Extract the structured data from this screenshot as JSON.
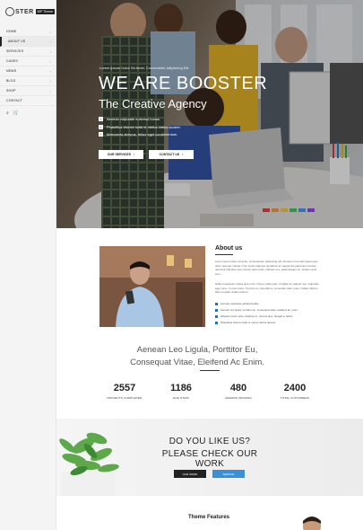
{
  "logo": {
    "text": "STER",
    "badge": "WP Theme"
  },
  "nav": {
    "items": [
      {
        "label": "HOME",
        "chevron": "›"
      },
      {
        "label": "ABOUT US",
        "chevron": "›"
      },
      {
        "label": "SERVICES",
        "chevron": "›"
      },
      {
        "label": "CASES",
        "chevron": "›"
      },
      {
        "label": "NEWS",
        "chevron": "›"
      },
      {
        "label": "BLOG",
        "chevron": "›"
      },
      {
        "label": "SHOP",
        "chevron": "›"
      },
      {
        "label": "CONTACT",
        "chevron": ""
      }
    ],
    "search_icon": "⌕",
    "cart_icon": "🛒"
  },
  "hero": {
    "small": "Lorem ipsum Dolor Sit Amet, Consectetur Adipiscing Elit.",
    "title": "WE ARE BOOSTER",
    "subtitle": "The Creative Agency",
    "list": [
      "Aenean vulputate euismod luctus.",
      "Phasellus viverra nulla ut metus varius laoreet.",
      "Maecenas tempus, tellus eget condimentum."
    ],
    "btn_services": "OUR SERVICES",
    "btn_contact": "CONTACT US",
    "btn_icon": "›"
  },
  "about": {
    "title": "About us",
    "p1": "Lorem ipsum dolor sit amet, consectetuer adipiscing elit. Aenean commodo ligula eget dolor. Aenean massa. Cum sociis natoque penatibus et magnis dis parturient montes, nascetur ridiculus mus. Donec quam felis, ultricies nec, pellentesque eu, pretium quis, sem.",
    "p2": "Nulla consequat massa quis enim. Donec pede justo, fringilla vel, aliquet nec, vulputate eget, arcu. In enim justo, rhoncus ut, imperdiet a, venenatis vitae, justo. Nullam dictum felis eu pede mollis pretium.",
    "list": [
      "Aenean vulputate eleifend tellus.",
      "Aenean leo ligula, porttitor eu, consequat vitae, eleifend ac, enim.",
      "Aliquam lorem ante, dapibus in, viverra quis, feugiat a, tellus.",
      "Phasellus viverra nulla ut metus varius laoreet."
    ]
  },
  "quote": {
    "line1": "Aenean Leo Ligula, Porttitor Eu,",
    "line2": "Consequat Vitae, Eleifend Ac Enim."
  },
  "stats": [
    {
      "num": "2557",
      "label": "PROJECTS COMPLETED"
    },
    {
      "num": "1186",
      "label": "OUR STAFF"
    },
    {
      "num": "480",
      "label": "AWARDS WINNING"
    },
    {
      "num": "2400",
      "label": "TOTAL CUSTOMERS"
    }
  ],
  "banner": {
    "line1": "DO YOU LIKE US?",
    "line2": "PLEASE CHECK OUR WORK",
    "btn_dark": "OUR WORK",
    "btn_blue": "SERVICE"
  },
  "features": {
    "title": "Theme Features"
  }
}
